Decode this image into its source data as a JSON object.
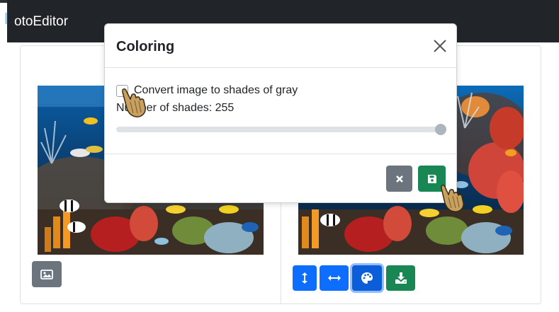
{
  "app": {
    "brand": "otoEditor"
  },
  "modal": {
    "title": "Coloring",
    "grayscale_label": "Convert image to shades of gray",
    "grayscale_checked": false,
    "shades_text": "Number of shades: 255",
    "shades_value": 255,
    "shades_max": 255,
    "shades_min": 1
  },
  "icons": {
    "close": "close-icon",
    "cancel": "x-icon",
    "save": "floppy-disk-icon",
    "image": "image-icon",
    "flip_vertical": "arrows-vertical-icon",
    "flip_horizontal": "arrows-horizontal-icon",
    "palette": "palette-icon",
    "download": "download-icon"
  },
  "colors": {
    "navbar": "#212529",
    "primary": "#0d6efd",
    "primary_active": "#0b5ed7",
    "secondary": "#6c757d",
    "success": "#198754"
  }
}
